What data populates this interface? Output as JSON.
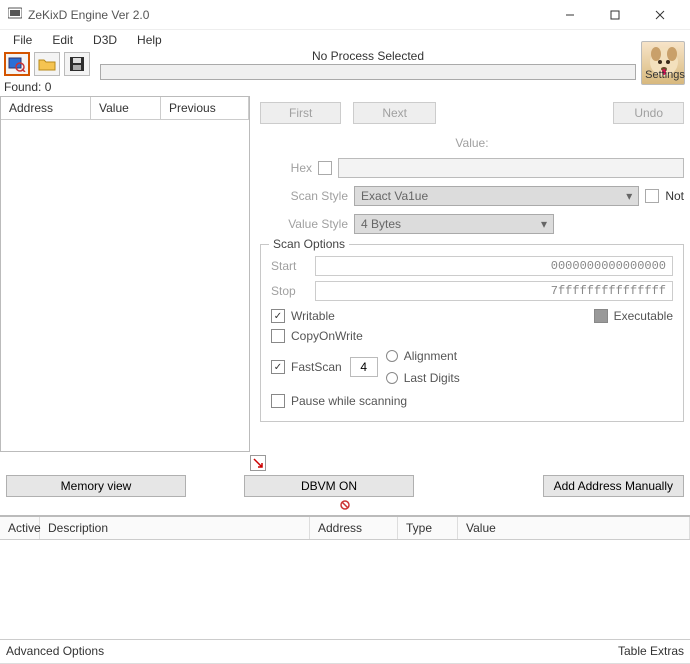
{
  "window": {
    "title": "ZeKixD Engine Ver 2.0",
    "process_status": "No Process Selected",
    "found_label": "Found: 0",
    "settings_label": "Settings"
  },
  "menu": {
    "items": [
      "File",
      "Edit",
      "D3D",
      "Help"
    ]
  },
  "toolbar_icons": {
    "process": "process-icon",
    "open": "open-folder-icon",
    "save": "save-icon"
  },
  "results_columns": [
    "Address",
    "Value",
    "Previous"
  ],
  "scan": {
    "first_btn": "First",
    "next_btn": "Next",
    "undo_btn": "Undo",
    "value_label": "Value:",
    "hex_label": "Hex",
    "scan_style_label": "Scan Style",
    "scan_style_value": "Exact Va1ue",
    "not_label": "Not",
    "value_style_label": "Value Style",
    "value_style_value": "4 Bytes"
  },
  "options": {
    "legend": "Scan Options",
    "start_label": "Start",
    "start_value": "0000000000000000",
    "stop_label": "Stop",
    "stop_value": "7fffffffffffffff",
    "writable": "Writable",
    "executable": "Executable",
    "copyonwrite": "CopyOnWrite",
    "fastscan": "FastScan",
    "fastscan_value": "4",
    "alignment": "Alignment",
    "lastdigits": "Last Digits",
    "pause": "Pause while scanning"
  },
  "midbuttons": {
    "memory_view": "Memory view",
    "dbvm": "DBVM ON",
    "add_manual": "Add Address Manually"
  },
  "bottom_columns": [
    "Active",
    "Description",
    "Address",
    "Type",
    "Value"
  ],
  "status": {
    "left": "Advanced Options",
    "right": "Table Extras"
  }
}
